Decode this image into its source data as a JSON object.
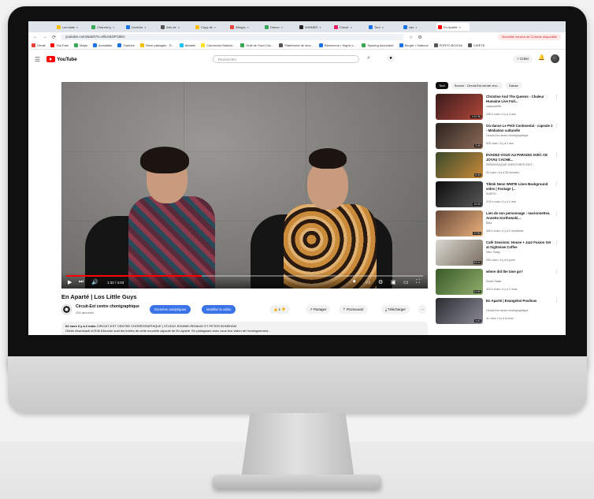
{
  "browser": {
    "tabs": [
      {
        "label": "Les stats",
        "color": "#fbbc04",
        "active": false
      },
      {
        "label": "Channel p",
        "color": "#34a853",
        "active": false
      },
      {
        "label": "Duolicts",
        "color": "#1a73e8",
        "active": false
      },
      {
        "label": "Arts de",
        "color": "#555555",
        "active": false
      },
      {
        "label": "Copy de",
        "color": "#fbbc04",
        "active": false
      },
      {
        "label": "Allegra",
        "color": "#ea4335",
        "active": false
      },
      {
        "label": "Dance",
        "color": "#34a853",
        "active": false
      },
      {
        "label": "WINNER",
        "color": "#222222",
        "active": false
      },
      {
        "label": "Circuit",
        "color": "#e91e63",
        "active": false
      },
      {
        "label": "Tout",
        "color": "#1a73e8",
        "active": false
      },
      {
        "label": "cas",
        "color": "#1a73e8",
        "active": false
      },
      {
        "label": "En Aparté",
        "color": "#ff0000",
        "active": true
      }
    ],
    "url": "youtube.com/watch?v=9hUraNFC6Es",
    "update_label": "Nouvelle version de Chrome disponible",
    "bookmarks": [
      {
        "label": "Gmail",
        "color": "#ea4335"
      },
      {
        "label": "YouTube",
        "color": "#ff0000"
      },
      {
        "label": "Maps",
        "color": "#34a853"
      },
      {
        "label": "Actualités",
        "color": "#1a73e8"
      },
      {
        "label": "Traduire",
        "color": "#1a73e8"
      },
      {
        "label": "Drive partagés - S...",
        "color": "#fbbc04"
      },
      {
        "label": "Airtable",
        "color": "#18bfff"
      },
      {
        "label": "Connexion Mailchi...",
        "color": "#ffe01b"
      },
      {
        "label": "Outil de Suivi Circ...",
        "color": "#34a853"
      },
      {
        "label": "Plateforme de stoc...",
        "color": "#555555"
      },
      {
        "label": "Bienvenue • Signin L...",
        "color": "#1a73e8"
      },
      {
        "label": "Spacing document",
        "color": "#34a853"
      },
      {
        "label": "Burger • Stations",
        "color": "#1a73e8"
      },
      {
        "label": "PORTO BOCHA",
        "color": "#555555"
      },
      {
        "label": "VIDÉTE",
        "color": "#555555"
      }
    ]
  },
  "youtube": {
    "logo": "YouTube",
    "search_placeholder": "Rechercher",
    "create_label": "+ Créer"
  },
  "video": {
    "title": "En Aparté | Los Little Guys",
    "timecode": "1:32 / 4:03",
    "progress": 0.38,
    "channel_name": "Circuit-Est centre chorégraphique",
    "subscribers": "294 abonnés",
    "btn_analytics": "Données analytiques",
    "btn_edit": "Modifier la vidéo",
    "likes": "1",
    "share_label": "Partager",
    "promote_label": "Promouvoir",
    "download_label": "Télécharger",
    "desc_stats": "62 vues  il y a 2 mois",
    "desc_tags": "CIRCUIT-EST CENTRE CHORÉGRAPHIQUE | STUDIO JEANNE-RENAUD ET PETER BONEHAM",
    "desc_text": "Olivier Arseneault et Erik Elizondo sont les invités de cette nouvelle capsule de En Aparté. En partageant avec vous leur vision de l'enseignement..."
  },
  "sidebar": {
    "chips": [
      {
        "label": "Tout",
        "active": true
      },
      {
        "label": "Source : Circuit-Est centre cho...",
        "active": false
      },
      {
        "label": "Danse",
        "active": false
      }
    ],
    "items": [
      {
        "title": "Christine And The Queens - Chaleur Humaine Live Full...",
        "channel": "cassoulet99",
        "meta": "238 k vues • il y a 4 ans",
        "duration": "1:02:36",
        "c1": "#3a1c1a",
        "c2": "#b3473a"
      },
      {
        "title": "Où danse Le Petit Continental - capsule 2 - Médiation culturelle",
        "channel": "Circuit-Est centre chorégraphique",
        "meta": "525 vues • il y a 2 ans",
        "duration": "3:49",
        "c1": "#2a2320",
        "c2": "#8d6a55"
      },
      {
        "title": "ÉVADEZ-VOUS AU PARADIS AVEC CE JOYAU CACHÉ...",
        "channel": "PARADISIAQUE AVENTURES EDIT...",
        "meta": "25 vues • il y a 30 minutes",
        "duration": "6:33",
        "c1": "#3b4a2b",
        "c2": "#c98a3a"
      },
      {
        "title": "Tiktok Neon WHITE Lines Background video | Footage |...",
        "channel": "SUEPO",
        "meta": "3 M k vues • il y a 2 ans",
        "duration": "10:00",
        "c1": "#0c0c0c",
        "c2": "#5a5a5a"
      },
      {
        "title": "Lien de son personnage : marionnettes, Annette Korthewski...",
        "channel": "Béla",
        "meta": "406 k vues • il y a 2 semaines",
        "duration": "17:51",
        "c1": "#6a4a3a",
        "c2": "#e8b07a"
      },
      {
        "title": "Café Sessions: House + Jazz Fusion Set at Sightview Coffee",
        "channel": "Vibe Today",
        "meta": "205 vues • il y a 6 jours",
        "duration": "43:11",
        "c1": "#d8d8d0",
        "c2": "#7a6d60"
      },
      {
        "title": "where did the time go?",
        "channel": "Sonia Sakai",
        "meta": "423 k vues • il y a 2 mois",
        "duration": "11:00",
        "c1": "#3a5a2a",
        "c2": "#8fae6a"
      },
      {
        "title": "En Aparté | Evangelos Poulinas",
        "channel": "Circuit-Est centre chorégraphique",
        "meta": "41 vues • il y a 8 mois",
        "duration": "4:41",
        "c1": "#2c2c32",
        "c2": "#8a8a96"
      }
    ]
  }
}
